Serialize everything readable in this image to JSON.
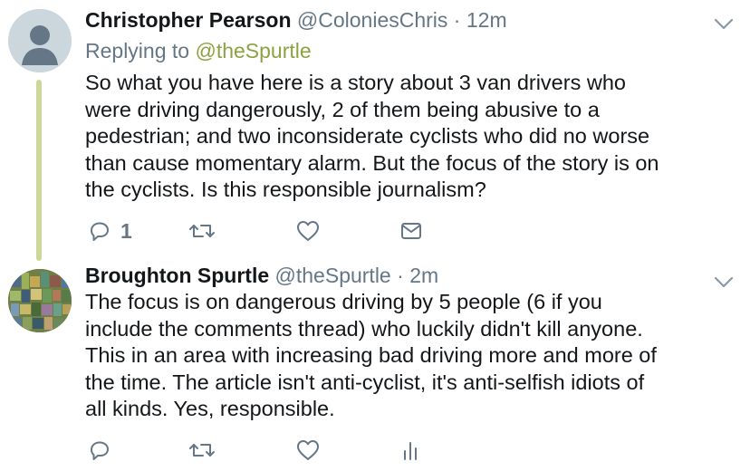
{
  "tweets": [
    {
      "name": "Christopher Pearson",
      "handle": "@ColoniesChris",
      "separator": "·",
      "time": "12m",
      "replying_prefix": "Replying to",
      "replying_handle": "@theSpurtle",
      "lines": [
        "So what you have here is a story about 3 van drivers who",
        "were driving dangerously, 2 of them being abusive to a",
        "pedestrian; and two inconsiderate cyclists who did no worse",
        "than cause momentary alarm. But the focus of the story is on",
        "the cyclists. Is this responsible journalism?"
      ],
      "reply_count": "1",
      "action_icons": [
        "reply-icon",
        "retweet-icon",
        "like-icon",
        "dm-icon"
      ]
    },
    {
      "name": "Broughton Spurtle",
      "handle": "@theSpurtle",
      "separator": "·",
      "time": "2m",
      "lines": [
        "The focus is on dangerous driving by 5 people (6 if you",
        "include the comments thread) who luckily didn't kill anyone.",
        "This in an area with increasing bad driving more and more of",
        "the time. The article isn't anti-cyclist, it's anti-selfish idiots of",
        "all kinds. Yes, responsible."
      ],
      "action_icons": [
        "reply-icon",
        "retweet-icon",
        "like-icon",
        "analytics-icon"
      ]
    }
  ],
  "colors": {
    "text": "#14171a",
    "muted": "#657786",
    "reply_handle": "#8ea141",
    "thread_line": "#cdd79a"
  }
}
